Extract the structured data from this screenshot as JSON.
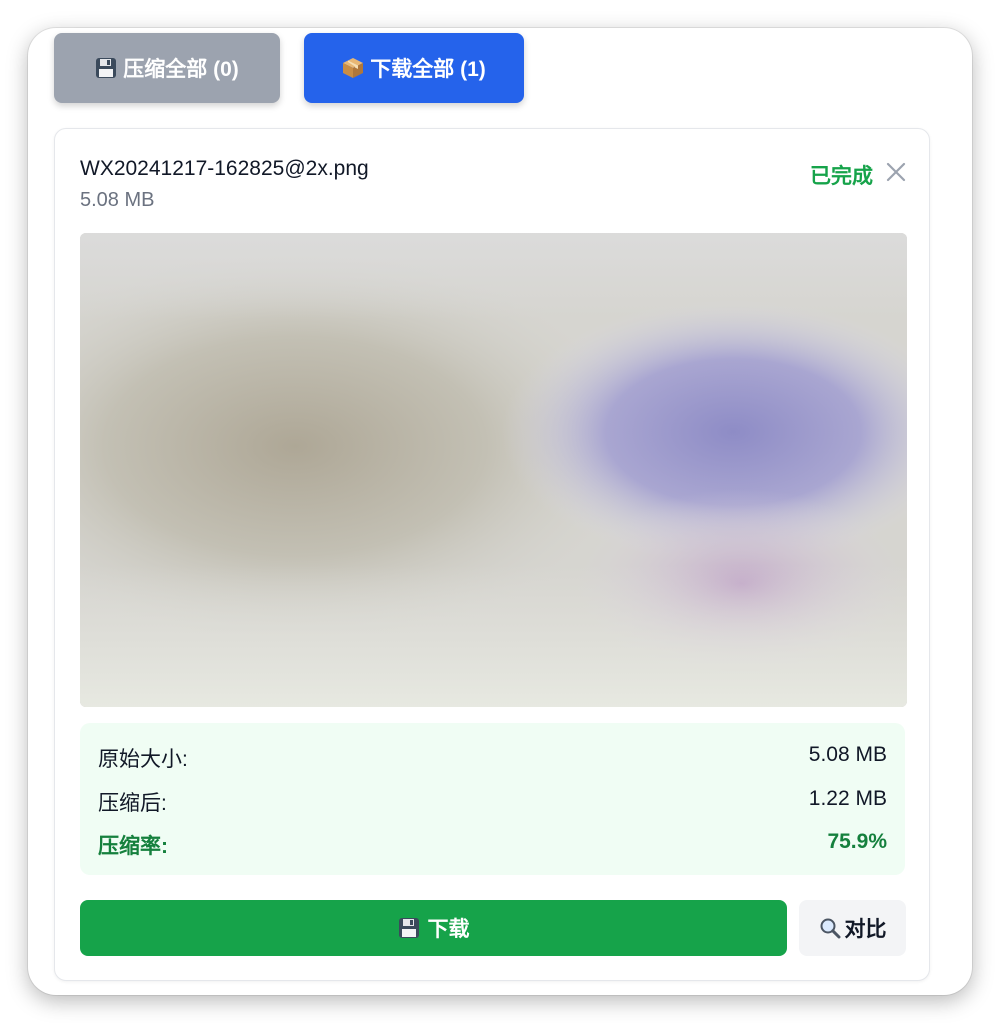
{
  "toolbar": {
    "compress_all_label": "压缩全部 (0)",
    "download_all_label": "下载全部 (1)",
    "compress_all_icon": "floppy-disk-icon",
    "download_all_icon": "package-icon"
  },
  "file": {
    "name": "WX20241217-162825@2x.png",
    "size": "5.08 MB",
    "status": "已完成",
    "close_icon": "close-icon"
  },
  "stats": {
    "original_label": "原始大小:",
    "original_value": "5.08 MB",
    "compressed_label": "压缩后:",
    "compressed_value": "1.22 MB",
    "ratio_label": "压缩率:",
    "ratio_value": "75.9%"
  },
  "actions": {
    "download_label": "下载",
    "download_icon": "floppy-disk-icon",
    "compare_label": "对比",
    "compare_icon": "magnifier-icon"
  },
  "colors": {
    "primary_blue": "#2563eb",
    "disabled_gray": "#9ca3af",
    "success_green": "#16a34a",
    "stats_bg": "#f0fdf4"
  }
}
